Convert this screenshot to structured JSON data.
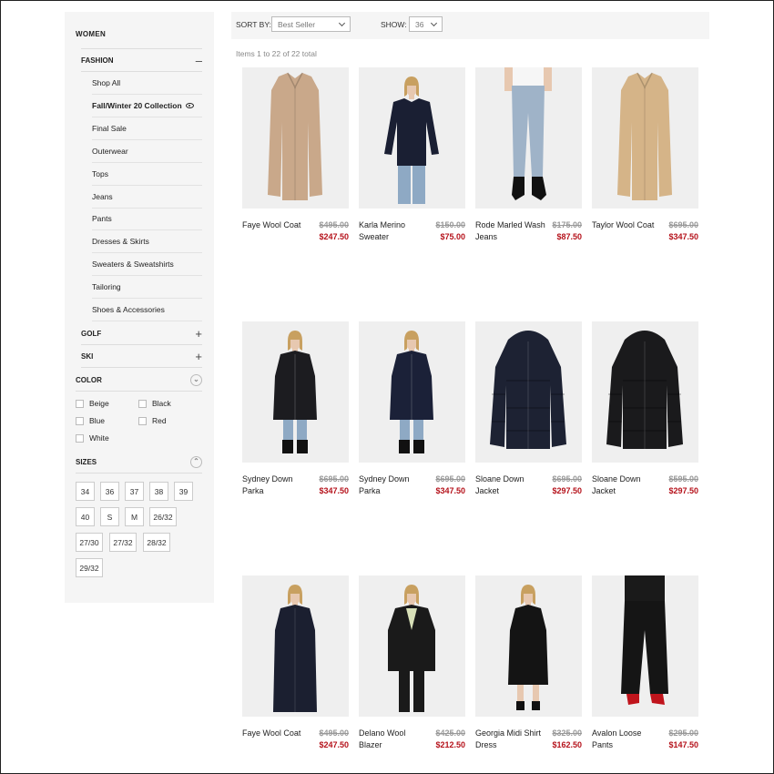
{
  "sidebar": {
    "section": "WOMEN",
    "fashion": {
      "label": "FASHION",
      "items": [
        "Shop All",
        "Fall/Winter 20 Collection",
        "Final Sale",
        "Outerwear",
        "Tops",
        "Jeans",
        "Pants",
        "Dresses & Skirts",
        "Sweaters & Sweatshirts",
        "Tailoring",
        "Shoes & Accessories"
      ],
      "active_index": 1
    },
    "categories": [
      "GOLF",
      "SKI"
    ],
    "color": {
      "label": "COLOR",
      "options": [
        "Beige",
        "Black",
        "Blue",
        "Red",
        "White"
      ]
    },
    "sizes": {
      "label": "SIZES",
      "options": [
        "34",
        "36",
        "37",
        "38",
        "39",
        "40",
        "S",
        "M",
        "26/32",
        "27/30",
        "27/32",
        "28/32",
        "29/32"
      ]
    }
  },
  "toolbar": {
    "sort_label": "SORT BY:",
    "sort_value": "Best Seller",
    "show_label": "SHOW:",
    "show_value": "36"
  },
  "items_count": "Items 1 to 22 of 22 total",
  "products": [
    {
      "name": "Faye Wool Coat",
      "old_price": "$495.00",
      "price": "$247.50",
      "garment": "long-coat",
      "color": "#c9a88a"
    },
    {
      "name": "Karla Merino Sweater",
      "old_price": "$150.00",
      "price": "$75.00",
      "garment": "sweater",
      "color": "#1a1f33"
    },
    {
      "name": "Rode Marled Wash Jeans",
      "old_price": "$175.00",
      "price": "$87.50",
      "garment": "jeans",
      "color": "#9fb3c8"
    },
    {
      "name": "Taylor Wool Coat",
      "old_price": "$695.00",
      "price": "$347.50",
      "garment": "long-coat",
      "color": "#d5b488"
    },
    {
      "name": "Sydney Down Parka",
      "old_price": "$695.00",
      "price": "$347.50",
      "garment": "parka-model",
      "color": "#1c1c20"
    },
    {
      "name": "Sydney Down Parka",
      "old_price": "$695.00",
      "price": "$347.50",
      "garment": "parka-model",
      "color": "#1b2138"
    },
    {
      "name": "Sloane Down Jacket",
      "old_price": "$695.00",
      "price": "$297.50",
      "garment": "puffer",
      "color": "#1d2233"
    },
    {
      "name": "Sloane Down Jacket",
      "old_price": "$595.00",
      "price": "$297.50",
      "garment": "puffer",
      "color": "#1a1a1c"
    },
    {
      "name": "Faye Wool Coat",
      "old_price": "$495.00",
      "price": "$247.50",
      "garment": "coat-model",
      "color": "#1b1f30"
    },
    {
      "name": "Delano Wool Blazer",
      "old_price": "$425.00",
      "price": "$212.50",
      "garment": "blazer-model",
      "color": "#1a1a1a"
    },
    {
      "name": "Georgia Midi Shirt Dress",
      "old_price": "$325.00",
      "price": "$162.50",
      "garment": "dress-model",
      "color": "#141414"
    },
    {
      "name": "Avalon Loose Pants",
      "old_price": "$295.00",
      "price": "$147.50",
      "garment": "pants-model",
      "color": "#151515"
    }
  ]
}
